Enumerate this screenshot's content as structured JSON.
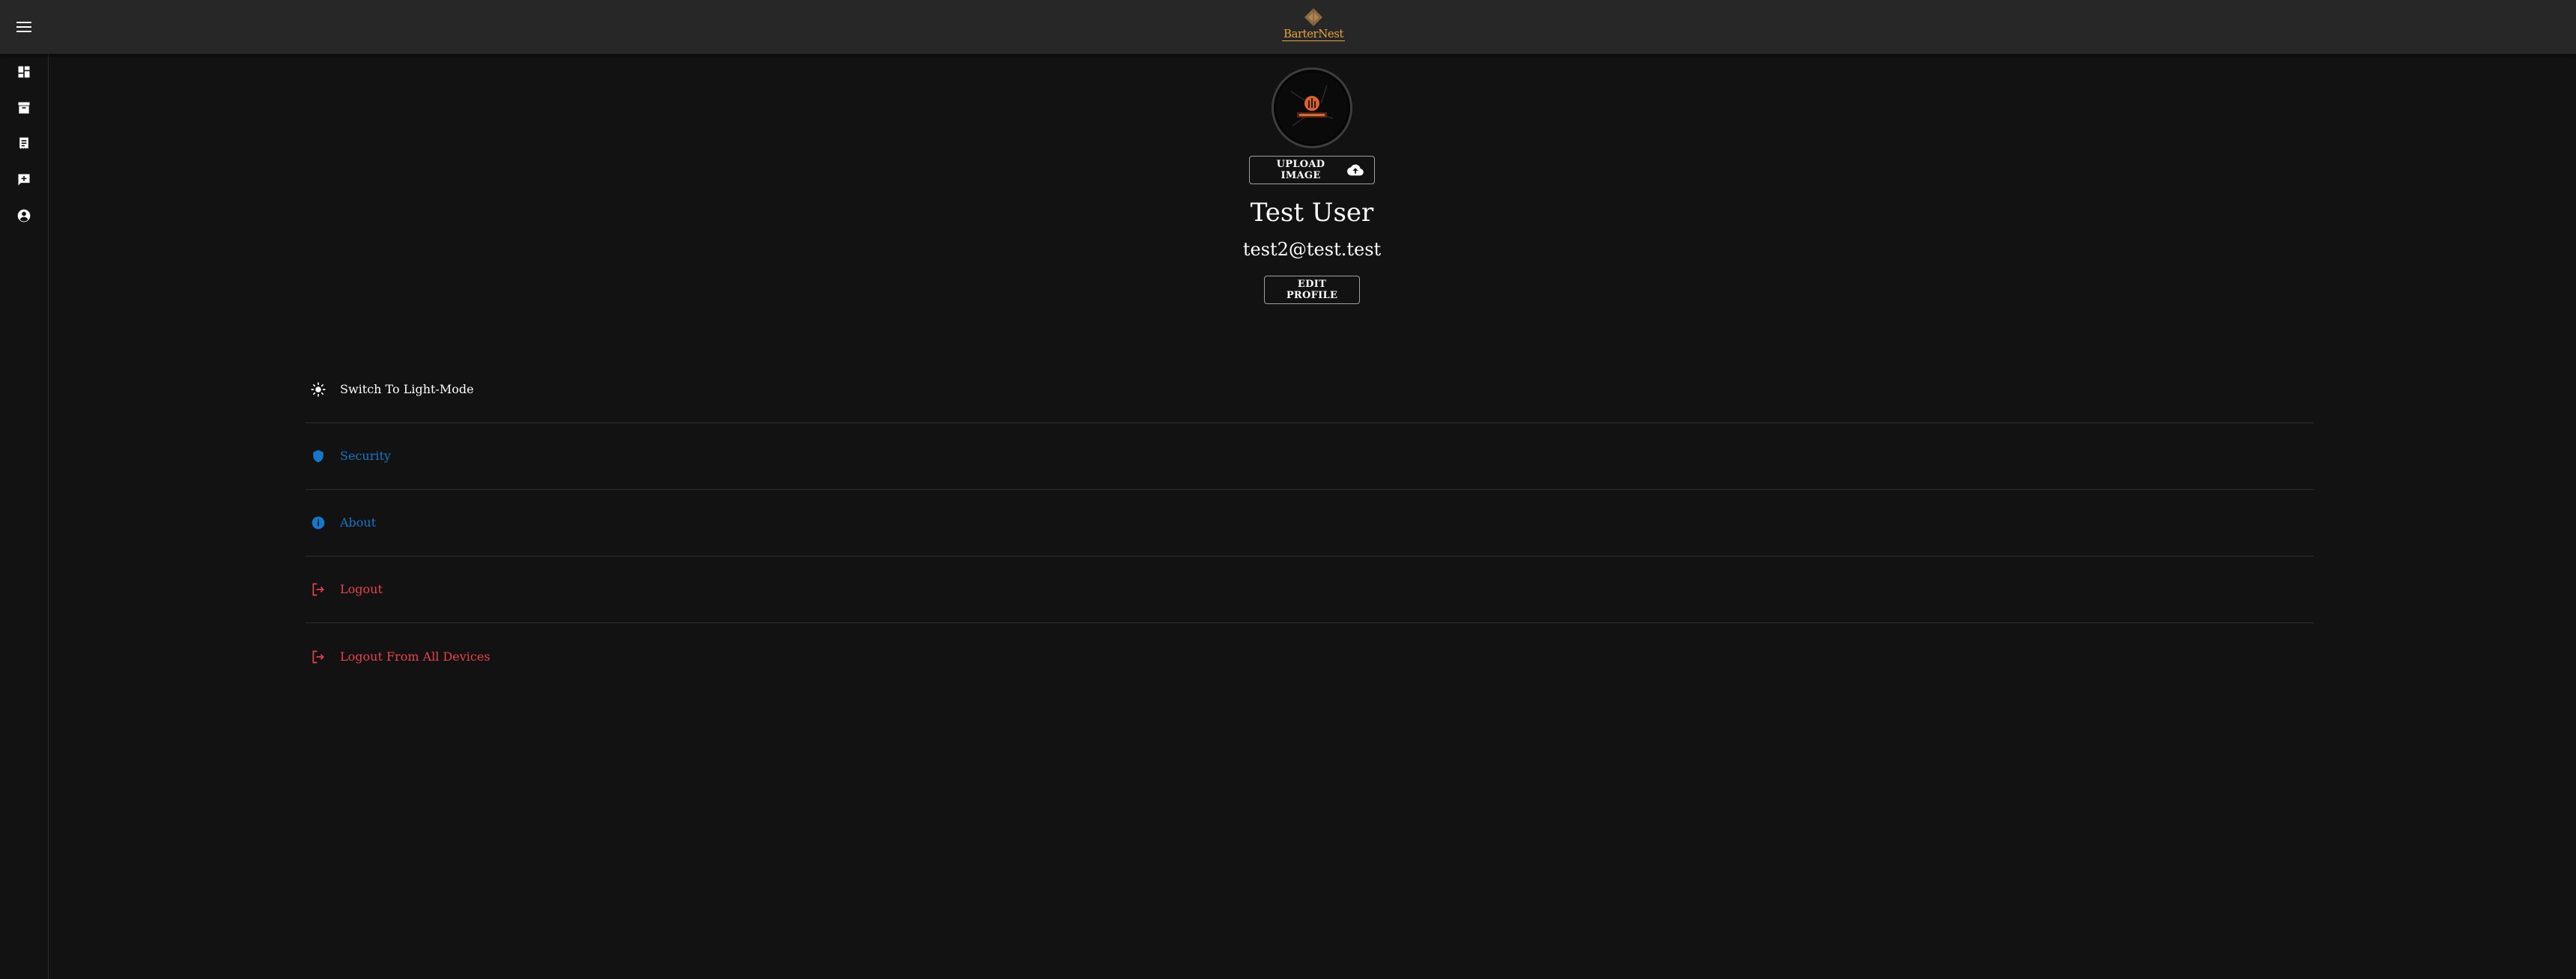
{
  "app": {
    "brand": "BarterNest",
    "colors": {
      "background": "#121212",
      "appbar": "#272727",
      "brand": "#e6a23c",
      "link_blue": "#1677c9",
      "danger_red": "#e8424b"
    }
  },
  "nav": {
    "menu_icon": "hamburger-menu-icon",
    "rail_icons": [
      "dashboard-icon",
      "archive-icon",
      "receipt-icon",
      "add-comment-icon",
      "account-circle-icon"
    ]
  },
  "profile": {
    "upload_label": "UPLOAD IMAGE",
    "upload_icon": "cloud-upload-icon",
    "name": "Test User",
    "email": "test2@test.test",
    "edit_label": "EDIT PROFILE",
    "avatar_icon": "profile-avatar-image"
  },
  "settings": {
    "items": [
      {
        "label": "Switch To Light-Mode",
        "icon": "sun-icon",
        "color": "#ffffff"
      },
      {
        "label": "Security",
        "icon": "shield-icon",
        "color": "#1677c9"
      },
      {
        "label": "About",
        "icon": "info-icon",
        "color": "#1677c9"
      },
      {
        "label": "Logout",
        "icon": "logout-icon",
        "color": "#e8424b"
      },
      {
        "label": "Logout From All Devices",
        "icon": "logout-icon",
        "color": "#e8424b"
      }
    ]
  }
}
